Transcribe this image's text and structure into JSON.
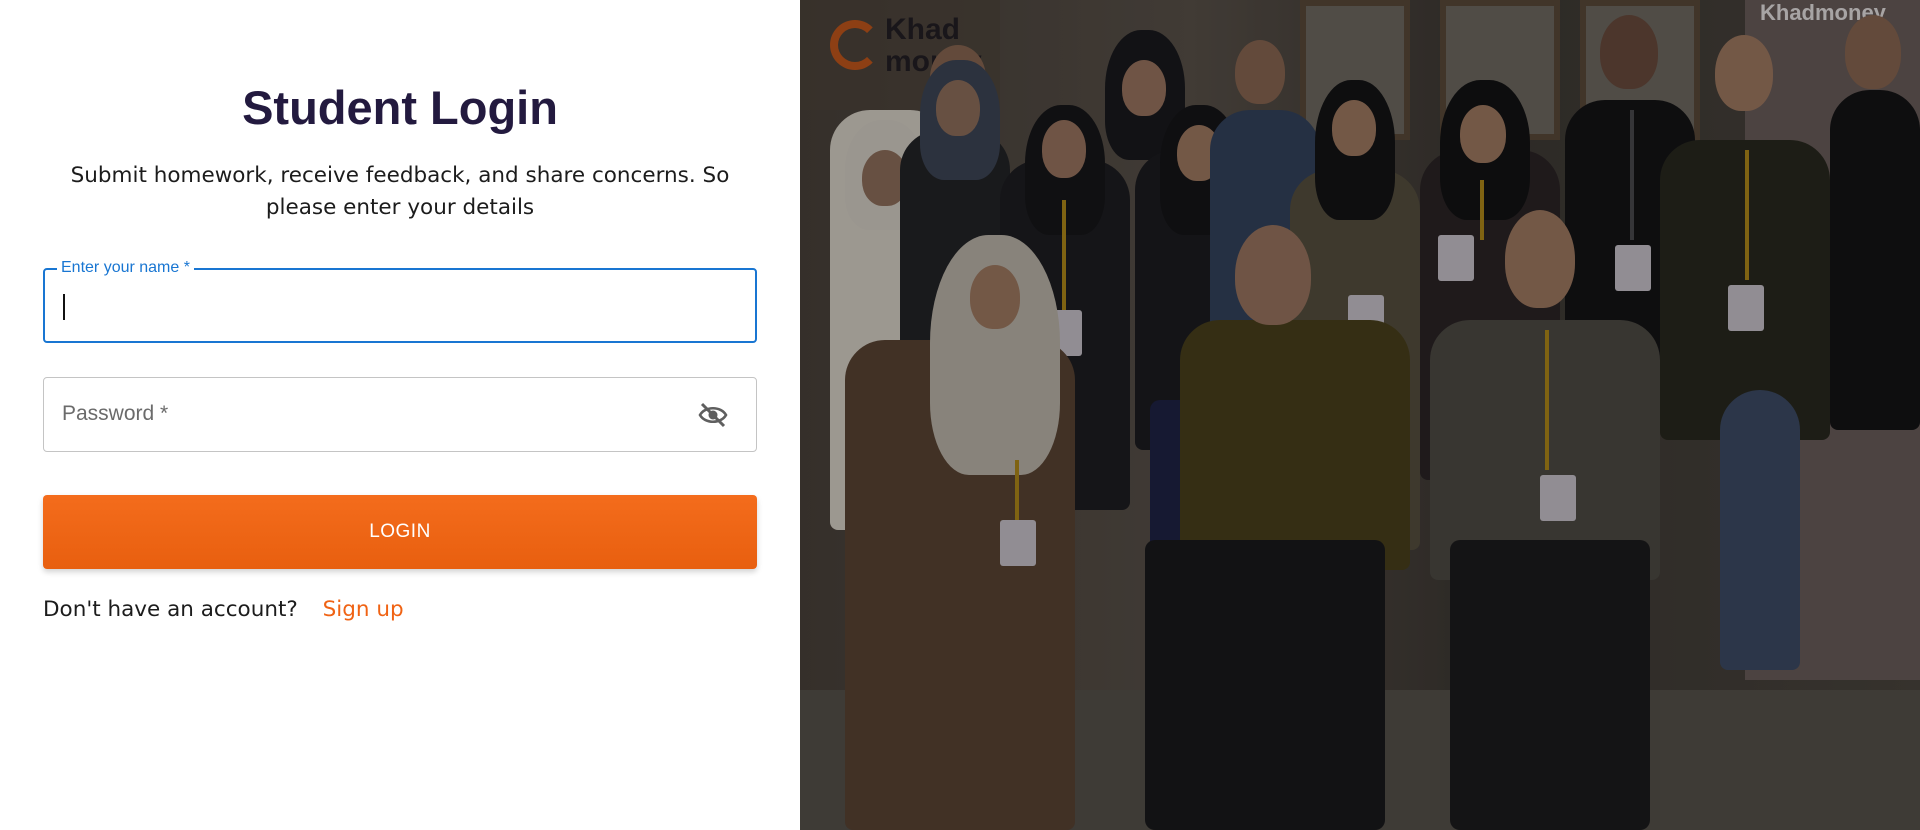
{
  "login": {
    "title": "Student Login",
    "subtitle": "Submit homework, receive feedback, and share concerns. So please enter your details",
    "name_field": {
      "label": "Enter your name *",
      "value": ""
    },
    "password_field": {
      "placeholder": "Password *",
      "value": "",
      "toggle_icon": "eye-off-icon"
    },
    "login_button": "LOGIN",
    "signup_prompt": "Don't have an account?",
    "signup_link": "Sign up"
  },
  "photo": {
    "logo_text": "Khad\nmoney",
    "banner_title": "Khadmoney"
  },
  "colors": {
    "accent_orange": "#f06314",
    "focus_blue": "#1976d2",
    "title_color": "#231a3f"
  }
}
